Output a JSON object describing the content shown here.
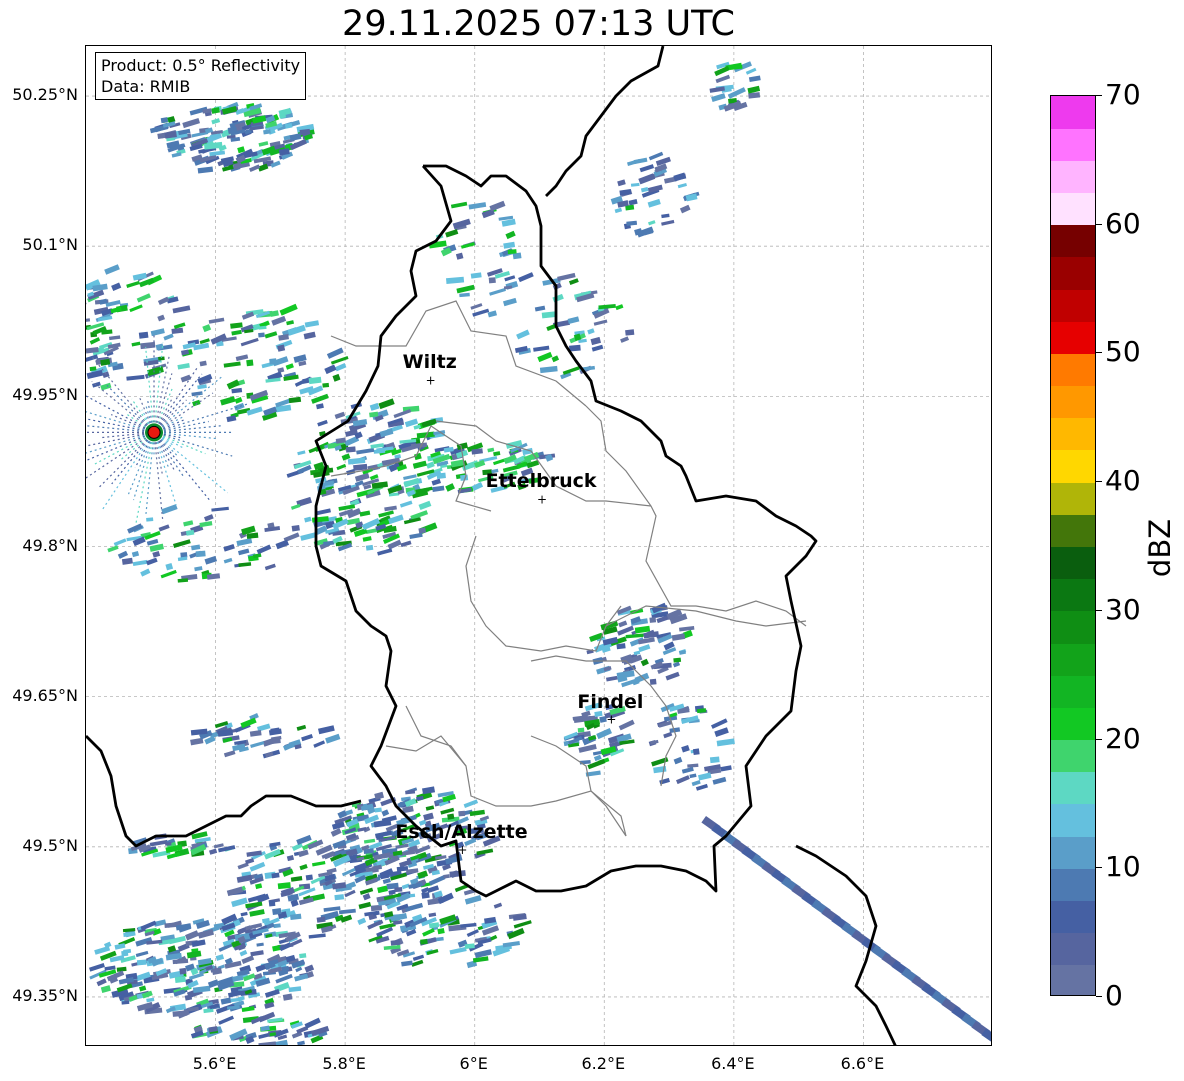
{
  "title": "29.11.2025 07:13 UTC",
  "info": {
    "product": "Product: 0.5° Reflectivity",
    "source": "Data: RMIB"
  },
  "map": {
    "extent": {
      "lon_min": 5.4,
      "lon_max": 6.8,
      "lat_min": 49.3,
      "lat_max": 50.3
    },
    "lat_ticks": [
      {
        "value": 50.25,
        "label": "50.25°N"
      },
      {
        "value": 50.1,
        "label": "50.1°N"
      },
      {
        "value": 49.95,
        "label": "49.95°N"
      },
      {
        "value": 49.8,
        "label": "49.8°N"
      },
      {
        "value": 49.65,
        "label": "49.65°N"
      },
      {
        "value": 49.5,
        "label": "49.5°N"
      },
      {
        "value": 49.35,
        "label": "49.35°N"
      }
    ],
    "lon_ticks": [
      {
        "value": 5.6,
        "label": "5.6°E"
      },
      {
        "value": 5.8,
        "label": "5.8°E"
      },
      {
        "value": 6.0,
        "label": "6°E"
      },
      {
        "value": 6.2,
        "label": "6.2°E"
      },
      {
        "value": 6.4,
        "label": "6.4°E"
      },
      {
        "value": 6.6,
        "label": "6.6°E"
      }
    ],
    "cities": [
      {
        "name": "Wiltz",
        "lon": 5.932,
        "lat": 49.966
      },
      {
        "name": "Ettelbruck",
        "lon": 6.104,
        "lat": 49.847
      },
      {
        "name": "Findel",
        "lon": 6.211,
        "lat": 49.627
      },
      {
        "name": "Esch/Alzette",
        "lon": 5.981,
        "lat": 49.497
      }
    ],
    "radar_site": {
      "lon": 5.505,
      "lat": 49.914,
      "color": "#e8190f"
    },
    "border_color": "#000000",
    "canton_color": "#808080"
  },
  "colorbar": {
    "unit": "dBZ",
    "min": 0,
    "max": 70,
    "step": 2.5,
    "tick_labels": [
      "0",
      "10",
      "20",
      "30",
      "40",
      "50",
      "60",
      "70"
    ],
    "colors": [
      "#6573a3",
      "#56659f",
      "#4560a3",
      "#4d7ab2",
      "#5a9ec9",
      "#64c0de",
      "#5dd8c3",
      "#3fd46d",
      "#12c823",
      "#12b523",
      "#12a31a",
      "#0f8e14",
      "#0b7812",
      "#0a5e0e",
      "#43760a",
      "#b0b508",
      "#ffd700",
      "#ffb800",
      "#ff9800",
      "#ff7a00",
      "#e60000",
      "#c00000",
      "#9a0000",
      "#760000",
      "#ffe1ff",
      "#ffb4ff",
      "#ff73ff",
      "#ee3aee"
    ]
  }
}
